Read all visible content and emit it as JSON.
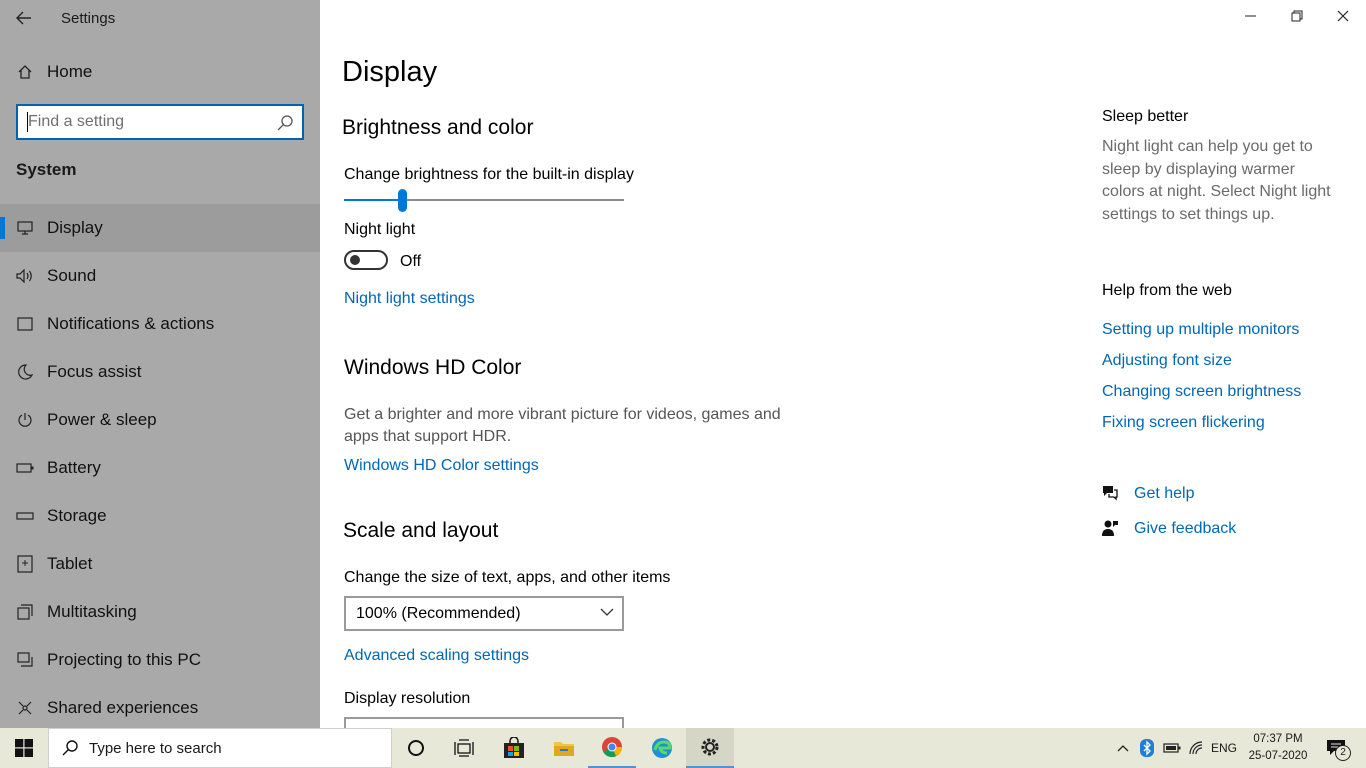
{
  "window": {
    "title": "Settings",
    "minimize_glyph": "—",
    "controls": [
      "minimize",
      "restore",
      "close"
    ]
  },
  "sidebar": {
    "home_label": "Home",
    "search_placeholder": "Find a setting",
    "section": "System",
    "items": [
      {
        "label": "Display",
        "icon": "monitor-icon",
        "selected": true
      },
      {
        "label": "Sound",
        "icon": "speaker-icon"
      },
      {
        "label": "Notifications & actions",
        "icon": "notification-icon"
      },
      {
        "label": "Focus assist",
        "icon": "moon-icon"
      },
      {
        "label": "Power & sleep",
        "icon": "power-icon"
      },
      {
        "label": "Battery",
        "icon": "battery-icon"
      },
      {
        "label": "Storage",
        "icon": "storage-icon"
      },
      {
        "label": "Tablet",
        "icon": "tablet-icon"
      },
      {
        "label": "Multitasking",
        "icon": "multitasking-icon"
      },
      {
        "label": "Projecting to this PC",
        "icon": "projecting-icon"
      },
      {
        "label": "Shared experiences",
        "icon": "shared-icon"
      }
    ]
  },
  "main": {
    "title": "Display",
    "brightness": {
      "heading": "Brightness and color",
      "slider_label": "Change brightness for the built-in display",
      "value_fraction": 0.21
    },
    "night_light": {
      "label": "Night light",
      "state": "Off",
      "settings_link": "Night light settings"
    },
    "hd_color": {
      "heading": "Windows HD Color",
      "description": "Get a brighter and more vibrant picture for videos, games and apps that support HDR.",
      "link": "Windows HD Color settings"
    },
    "scale": {
      "heading": "Scale and layout",
      "size_label": "Change the size of text, apps, and other items",
      "size_value": "100% (Recommended)",
      "advanced_link": "Advanced scaling settings",
      "resolution_label": "Display resolution"
    }
  },
  "right": {
    "sleep_title": "Sleep better",
    "sleep_desc": "Night light can help you get to sleep by displaying warmer colors at night. Select Night light settings to set things up.",
    "help_title": "Help from the web",
    "help_links": [
      "Setting up multiple monitors",
      "Adjusting font size",
      "Changing screen brightness",
      "Fixing screen flickering"
    ],
    "get_help": "Get help",
    "give_feedback": "Give feedback"
  },
  "taskbar": {
    "search_placeholder": "Type here to search",
    "language": "ENG",
    "time": "07:37 PM",
    "date": "25-07-2020",
    "notification_count": "2"
  },
  "colors": {
    "accent": "#0078d7",
    "link": "#0067b8",
    "sidebar_bg": "#a9a9a9",
    "taskbar_bg": "#e8e8d8"
  }
}
